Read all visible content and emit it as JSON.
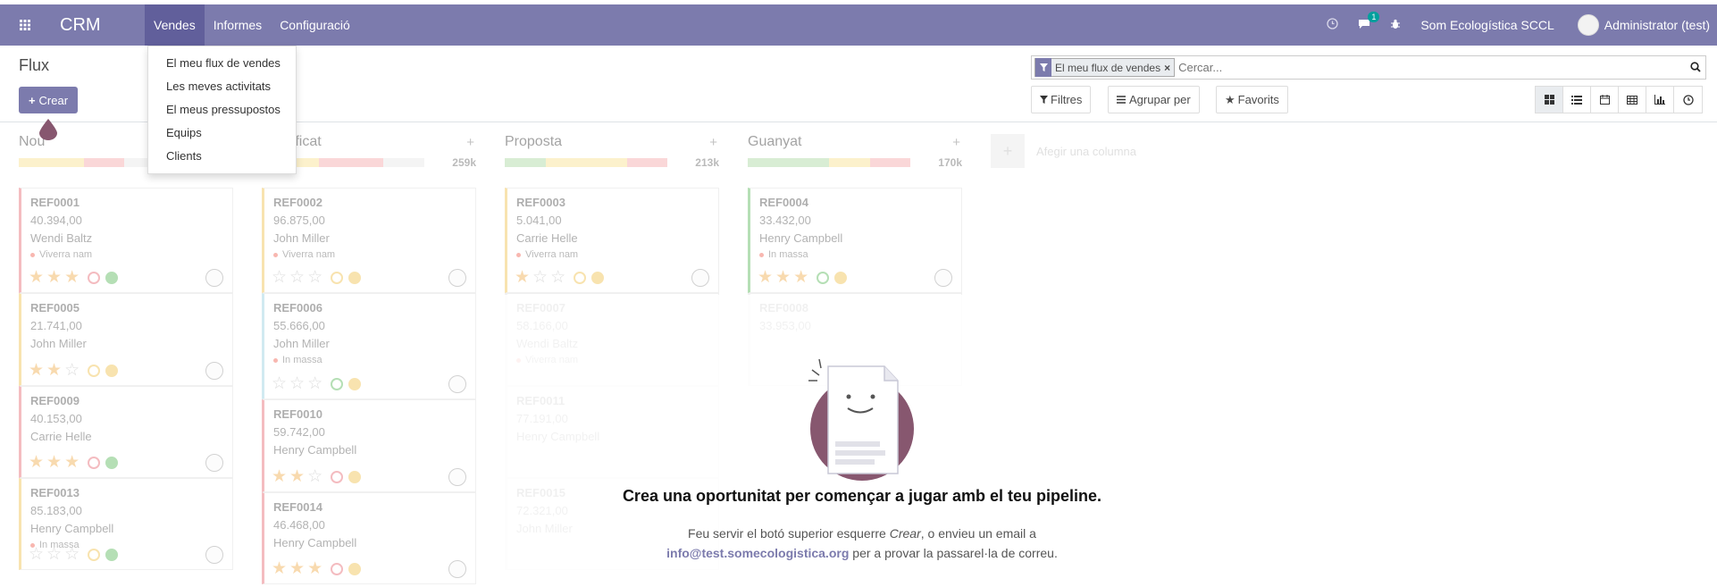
{
  "navbar": {
    "brand": "CRM",
    "menu": [
      "Vendes",
      "Informes",
      "Configuració"
    ],
    "chat_badge": "1",
    "company": "Som Ecologística SCCL",
    "user": "Administrator (test)"
  },
  "dropdown": {
    "items": [
      "El meu flux de vendes",
      "Les meves activitats",
      "El meus pressupostos",
      "Equips",
      "Clients"
    ]
  },
  "control_panel": {
    "breadcrumb": "Flux",
    "create_label": "Crear",
    "facet_label": "El meu flux de vendes",
    "search_placeholder": "Cercar...",
    "filters_label": "Filtres",
    "groupby_label": "Agrupar per",
    "favorites_label": "Favorits"
  },
  "kanban": {
    "columns": [
      {
        "title": "Nou",
        "total": "",
        "progress": [
          {
            "color": "#f8e08e",
            "pct": 0.4
          },
          {
            "color": "#f4a6a8",
            "pct": 0.25
          },
          {
            "color": "#e6e6e6",
            "pct": 0.35
          }
        ],
        "cards": [
          {
            "ref": "REF0001",
            "amount": "40.394,00",
            "customer": "Wendi Baltz",
            "tag": "Viverra nam",
            "stars": 3,
            "activity": "#e66a74"
          },
          {
            "ref": "REF0005",
            "amount": "21.741,00",
            "customer": "John Miller",
            "tag": "",
            "stars": 2,
            "activity": "#f0c04e"
          },
          {
            "ref": "REF0009",
            "amount": "40.153,00",
            "customer": "Carrie Helle",
            "tag": "",
            "stars": 3,
            "activity": "#e66a74"
          },
          {
            "ref": "REF0013",
            "amount": "85.183,00",
            "customer": "Henry Campbell",
            "tag": "In massa",
            "stars": 0,
            "activity": "#f0c04e"
          }
        ]
      },
      {
        "title": "Qualificat",
        "total": "259k",
        "progress": [
          {
            "color": "#f8e08e",
            "pct": 0.35
          },
          {
            "color": "#f4a6a8",
            "pct": 0.4
          },
          {
            "color": "#e6e6e6",
            "pct": 0.25
          }
        ],
        "cards": [
          {
            "ref": "REF0002",
            "amount": "96.875,00",
            "customer": "John Miller",
            "tag": "Viverra nam",
            "stars": 0,
            "activity": "#f0c04e"
          },
          {
            "ref": "REF0006",
            "amount": "55.666,00",
            "customer": "John Miller",
            "tag": "In massa",
            "stars": 0,
            "activity": "#5cb85c"
          },
          {
            "ref": "REF0010",
            "amount": "59.742,00",
            "customer": "Henry Campbell",
            "tag": "",
            "stars": 2,
            "activity": "#e66a74"
          },
          {
            "ref": "REF0014",
            "amount": "46.468,00",
            "customer": "Henry Campbell",
            "tag": "",
            "stars": 3,
            "activity": "#e66a74"
          }
        ]
      },
      {
        "title": "Proposta",
        "total": "213k",
        "progress": [
          {
            "color": "#a8d8a0",
            "pct": 0.25
          },
          {
            "color": "#f8e08e",
            "pct": 0.5
          },
          {
            "color": "#f4a6a8",
            "pct": 0.25
          }
        ],
        "cards": [
          {
            "ref": "REF0003",
            "amount": "5.041,00",
            "customer": "Carrie Helle",
            "tag": "Viverra nam",
            "stars": 1,
            "activity": "#f0c04e"
          },
          {
            "ref": "REF0007",
            "amount": "58.166,00",
            "customer": "Wendi Baltz",
            "tag": "Viverra nam",
            "stars": 0,
            "activity": ""
          },
          {
            "ref": "REF0011",
            "amount": "77.191,00",
            "customer": "Henry Campbell",
            "tag": "",
            "stars": 2,
            "activity": ""
          },
          {
            "ref": "REF0015",
            "amount": "72.321,00",
            "customer": "John Miller",
            "tag": "",
            "stars": 0,
            "activity": ""
          }
        ]
      },
      {
        "title": "Guanyat",
        "total": "170k",
        "progress": [
          {
            "color": "#a8d8a0",
            "pct": 0.5
          },
          {
            "color": "#f8e08e",
            "pct": 0.25
          },
          {
            "color": "#f4a6a8",
            "pct": 0.25
          }
        ],
        "cards": [
          {
            "ref": "REF0004",
            "amount": "33.432,00",
            "customer": "Henry Campbell",
            "tag": "In massa",
            "stars": 3,
            "activity": "#5cb85c"
          },
          {
            "ref": "REF0008",
            "amount": "33.953,00",
            "customer": "",
            "tag": "",
            "stars": 0,
            "activity": ""
          }
        ]
      }
    ],
    "add_column_label": "Afegir una columna"
  },
  "helper": {
    "title": "Crea una oportunitat per començar a jugar amb el teu pipeline.",
    "line1_pre": "Feu servir el botó superior esquerre ",
    "line1_em": "Crear",
    "line1_post": ", o envieu un email a",
    "email": "info@test.somecologistica.org",
    "line2_post": " per a provar la passarel·la de correu."
  }
}
